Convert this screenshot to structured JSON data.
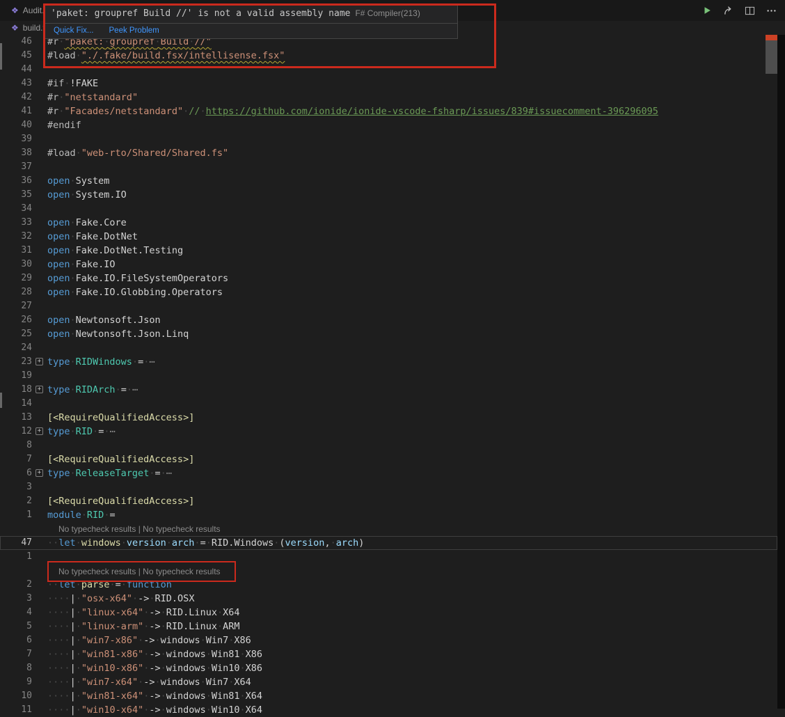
{
  "titlebar": {
    "tab_primary": "Audit.s",
    "tab_secondary": "build.f"
  },
  "icons": [
    "fsharp-file-icon",
    "run-icon",
    "share-icon",
    "split-editor-icon",
    "more-actions-icon",
    "fold-expand-icon"
  ],
  "hover": {
    "message": "'paket: groupref Build //' is not a valid assembly name",
    "source": "F# Compiler(213)",
    "quick_fix": "Quick Fix...",
    "peek_problem": "Peek Problem"
  },
  "codelens_text": "No typecheck results | No typecheck results",
  "colors": {
    "annotation_red": "#cb2a1d",
    "squiggle_yellow": "#b8a832",
    "keyword_blue": "#569cd6",
    "string_orange": "#ce9178",
    "type_teal": "#4ec9b0",
    "link_green": "#6a9955"
  },
  "editor": {
    "rows": [
      {
        "n": "46",
        "tokens": [
          [
            "#r ",
            "pre"
          ],
          [
            "\"paket: groupref Build //\"",
            "str sq"
          ]
        ]
      },
      {
        "n": "45",
        "tokens": [
          [
            "#load ",
            "pre"
          ],
          [
            "\"./.fake/build.fsx/intellisense.fsx\"",
            "str sq"
          ]
        ]
      },
      {
        "n": "44",
        "tokens": []
      },
      {
        "n": "43",
        "tokens": [
          [
            "#if ",
            "pre"
          ],
          [
            "!FAKE",
            "pln"
          ]
        ]
      },
      {
        "n": "42",
        "tokens": [
          [
            "#r ",
            "pre"
          ],
          [
            "\"netstandard\"",
            "str"
          ]
        ]
      },
      {
        "n": "41",
        "tokens": [
          [
            "#r ",
            "pre"
          ],
          [
            "\"Facades/netstandard\"",
            "str"
          ],
          [
            " ",
            "pln"
          ],
          [
            "// ",
            "cmt"
          ],
          [
            "https://github.com/ionide/ionide-vscode-fsharp/issues/839#issuecomment-396296095",
            "lnk"
          ]
        ]
      },
      {
        "n": "40",
        "tokens": [
          [
            "#endif",
            "pre"
          ]
        ]
      },
      {
        "n": "39",
        "tokens": []
      },
      {
        "n": "38",
        "tokens": [
          [
            "#load ",
            "pre"
          ],
          [
            "\"web-rto/Shared/Shared.fs\"",
            "str"
          ]
        ]
      },
      {
        "n": "37",
        "tokens": []
      },
      {
        "n": "36",
        "tokens": [
          [
            "open ",
            "kw"
          ],
          [
            "System",
            "pln"
          ]
        ]
      },
      {
        "n": "35",
        "tokens": [
          [
            "open ",
            "kw"
          ],
          [
            "System.IO",
            "pln"
          ]
        ]
      },
      {
        "n": "34",
        "tokens": []
      },
      {
        "n": "33",
        "tokens": [
          [
            "open ",
            "kw"
          ],
          [
            "Fake.Core",
            "pln"
          ]
        ]
      },
      {
        "n": "32",
        "tokens": [
          [
            "open ",
            "kw"
          ],
          [
            "Fake.DotNet",
            "pln"
          ]
        ]
      },
      {
        "n": "31",
        "tokens": [
          [
            "open ",
            "kw"
          ],
          [
            "Fake.DotNet.Testing",
            "pln"
          ]
        ]
      },
      {
        "n": "30",
        "tokens": [
          [
            "open ",
            "kw"
          ],
          [
            "Fake.IO",
            "pln"
          ]
        ]
      },
      {
        "n": "29",
        "tokens": [
          [
            "open ",
            "kw"
          ],
          [
            "Fake.IO.FileSystemOperators",
            "pln"
          ]
        ]
      },
      {
        "n": "28",
        "tokens": [
          [
            "open ",
            "kw"
          ],
          [
            "Fake.IO.Globbing.Operators",
            "pln"
          ]
        ]
      },
      {
        "n": "27",
        "tokens": []
      },
      {
        "n": "26",
        "tokens": [
          [
            "open ",
            "kw"
          ],
          [
            "Newtonsoft.Json",
            "pln"
          ]
        ]
      },
      {
        "n": "25",
        "tokens": [
          [
            "open ",
            "kw"
          ],
          [
            "Newtonsoft.Json.Linq",
            "pln"
          ]
        ]
      },
      {
        "n": "24",
        "tokens": []
      },
      {
        "n": "23",
        "fold": true,
        "tokens": [
          [
            "type ",
            "kw"
          ],
          [
            "RIDWindows",
            "typ"
          ],
          [
            " = ",
            "pln"
          ],
          [
            "⋯",
            "ell"
          ]
        ]
      },
      {
        "n": "19",
        "tokens": []
      },
      {
        "n": "18",
        "fold": true,
        "tokens": [
          [
            "type ",
            "kw"
          ],
          [
            "RIDArch",
            "typ"
          ],
          [
            " = ",
            "pln"
          ],
          [
            "⋯",
            "ell"
          ]
        ]
      },
      {
        "n": "14",
        "tokens": []
      },
      {
        "n": "13",
        "tokens": [
          [
            "[<RequireQualifiedAccess>]",
            "att"
          ]
        ]
      },
      {
        "n": "12",
        "fold": true,
        "tokens": [
          [
            "type ",
            "kw"
          ],
          [
            "RID",
            "typ"
          ],
          [
            " = ",
            "pln"
          ],
          [
            "⋯",
            "ell"
          ]
        ]
      },
      {
        "n": "8",
        "tokens": []
      },
      {
        "n": "7",
        "tokens": [
          [
            "[<RequireQualifiedAccess>]",
            "att"
          ]
        ]
      },
      {
        "n": "6",
        "fold": true,
        "tokens": [
          [
            "type ",
            "kw"
          ],
          [
            "ReleaseTarget",
            "typ"
          ],
          [
            " = ",
            "pln"
          ],
          [
            "⋯",
            "ell"
          ]
        ]
      },
      {
        "n": "3",
        "tokens": []
      },
      {
        "n": "2",
        "tokens": [
          [
            "[<RequireQualifiedAccess>]",
            "att"
          ]
        ]
      },
      {
        "n": "1",
        "tokens": [
          [
            "module ",
            "kw"
          ],
          [
            "RID",
            "typ"
          ],
          [
            " =",
            "pln"
          ]
        ]
      },
      {
        "kind": "codelens"
      },
      {
        "n": "47",
        "current": true,
        "tokens": [
          [
            "  ",
            "pln"
          ],
          [
            "let ",
            "kw"
          ],
          [
            "windows",
            "fn"
          ],
          [
            " ",
            "pln"
          ],
          [
            "version",
            "prm"
          ],
          [
            " ",
            "pln"
          ],
          [
            "arch",
            "prm"
          ],
          [
            " = ",
            "pln"
          ],
          [
            "RID.Windows",
            "pln"
          ],
          [
            " (",
            "pln"
          ],
          [
            "version",
            "prm"
          ],
          [
            ", ",
            "pln"
          ],
          [
            "arch",
            "prm"
          ],
          [
            ")",
            "pln"
          ]
        ]
      },
      {
        "n": "1",
        "tokens": []
      },
      {
        "kind": "codelens",
        "boxed": true
      },
      {
        "n": "2",
        "tokens": [
          [
            "  ",
            "pln"
          ],
          [
            "let ",
            "kw"
          ],
          [
            "parse",
            "fn"
          ],
          [
            " = ",
            "pln"
          ],
          [
            "function",
            "kw"
          ]
        ]
      },
      {
        "n": "3",
        "tokens": [
          [
            "    | ",
            "pln"
          ],
          [
            "\"osx-x64\"",
            "str"
          ],
          [
            " -> ",
            "pln"
          ],
          [
            "RID.OSX",
            "pln"
          ]
        ]
      },
      {
        "n": "4",
        "tokens": [
          [
            "    | ",
            "pln"
          ],
          [
            "\"linux-x64\"",
            "str"
          ],
          [
            " -> ",
            "pln"
          ],
          [
            "RID.Linux X64",
            "pln"
          ]
        ]
      },
      {
        "n": "5",
        "tokens": [
          [
            "    | ",
            "pln"
          ],
          [
            "\"linux-arm\"",
            "str"
          ],
          [
            " -> ",
            "pln"
          ],
          [
            "RID.Linux ARM",
            "pln"
          ]
        ]
      },
      {
        "n": "6",
        "tokens": [
          [
            "    | ",
            "pln"
          ],
          [
            "\"win7-x86\"",
            "str"
          ],
          [
            " -> ",
            "pln"
          ],
          [
            "windows Win7 X86",
            "pln"
          ]
        ]
      },
      {
        "n": "7",
        "tokens": [
          [
            "    | ",
            "pln"
          ],
          [
            "\"win81-x86\"",
            "str"
          ],
          [
            " -> ",
            "pln"
          ],
          [
            "windows Win81 X86",
            "pln"
          ]
        ]
      },
      {
        "n": "8",
        "tokens": [
          [
            "    | ",
            "pln"
          ],
          [
            "\"win10-x86\"",
            "str"
          ],
          [
            " -> ",
            "pln"
          ],
          [
            "windows Win10 X86",
            "pln"
          ]
        ]
      },
      {
        "n": "9",
        "tokens": [
          [
            "    | ",
            "pln"
          ],
          [
            "\"win7-x64\"",
            "str"
          ],
          [
            " -> ",
            "pln"
          ],
          [
            "windows Win7 X64",
            "pln"
          ]
        ]
      },
      {
        "n": "10",
        "tokens": [
          [
            "    | ",
            "pln"
          ],
          [
            "\"win81-x64\"",
            "str"
          ],
          [
            " -> ",
            "pln"
          ],
          [
            "windows Win81 X64",
            "pln"
          ]
        ]
      },
      {
        "n": "11",
        "tokens": [
          [
            "    | ",
            "pln"
          ],
          [
            "\"win10-x64\"",
            "str"
          ],
          [
            " -> ",
            "pln"
          ],
          [
            "windows Win10 X64",
            "pln"
          ]
        ]
      }
    ]
  }
}
